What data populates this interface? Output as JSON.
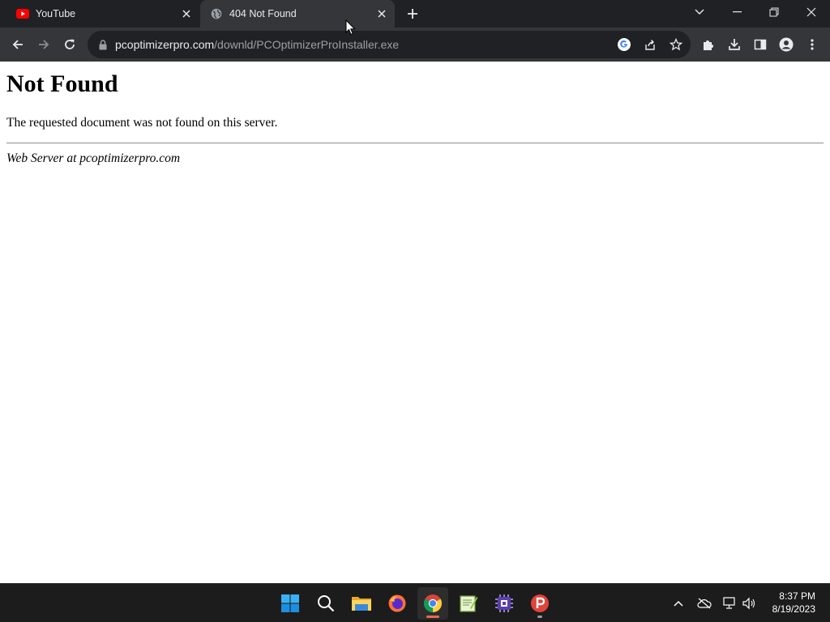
{
  "browser": {
    "tabs": [
      {
        "title": "YouTube",
        "icon": "youtube-icon",
        "active": false
      },
      {
        "title": "404 Not Found",
        "icon": "globe-icon",
        "active": true
      }
    ],
    "address": {
      "domain": "pcoptimizerpro.com",
      "path": "/downld/PCOptimizerProInstaller.exe"
    }
  },
  "page": {
    "heading": "Not Found",
    "message": "The requested document was not found on this server.",
    "signature": "Web Server at pcoptimizerpro.com"
  },
  "taskbar": {
    "apps": [
      {
        "name": "start",
        "icon": "windows-start-icon"
      },
      {
        "name": "search",
        "icon": "search-icon"
      },
      {
        "name": "file-explorer",
        "icon": "folder-icon"
      },
      {
        "name": "firefox",
        "icon": "firefox-icon"
      },
      {
        "name": "chrome",
        "icon": "chrome-icon",
        "active": true
      },
      {
        "name": "notepad-plus",
        "icon": "notepad-icon"
      },
      {
        "name": "cpu-tool",
        "icon": "cpu-chip-icon"
      },
      {
        "name": "psiphon",
        "icon": "p-app-icon"
      }
    ],
    "clock": {
      "time": "8:37 PM",
      "date": "8/19/2023"
    }
  },
  "colors": {
    "tab_strip": "#202124",
    "toolbar": "#35363a",
    "omnibox": "#202124",
    "taskbar": "#1c1c1c",
    "youtube_red": "#ff0000",
    "chrome_indicator": "#e86a4f"
  }
}
